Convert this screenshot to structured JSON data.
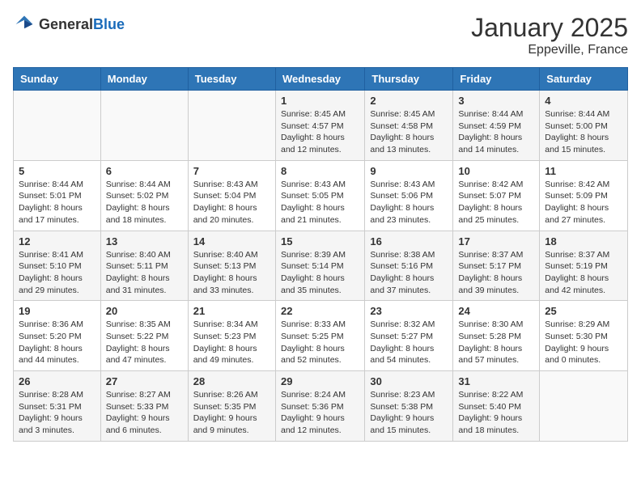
{
  "header": {
    "logo_general": "General",
    "logo_blue": "Blue",
    "month_title": "January 2025",
    "location": "Eppeville, France"
  },
  "days_of_week": [
    "Sunday",
    "Monday",
    "Tuesday",
    "Wednesday",
    "Thursday",
    "Friday",
    "Saturday"
  ],
  "weeks": [
    [
      {
        "day": "",
        "info": ""
      },
      {
        "day": "",
        "info": ""
      },
      {
        "day": "",
        "info": ""
      },
      {
        "day": "1",
        "info": "Sunrise: 8:45 AM\nSunset: 4:57 PM\nDaylight: 8 hours\nand 12 minutes."
      },
      {
        "day": "2",
        "info": "Sunrise: 8:45 AM\nSunset: 4:58 PM\nDaylight: 8 hours\nand 13 minutes."
      },
      {
        "day": "3",
        "info": "Sunrise: 8:44 AM\nSunset: 4:59 PM\nDaylight: 8 hours\nand 14 minutes."
      },
      {
        "day": "4",
        "info": "Sunrise: 8:44 AM\nSunset: 5:00 PM\nDaylight: 8 hours\nand 15 minutes."
      }
    ],
    [
      {
        "day": "5",
        "info": "Sunrise: 8:44 AM\nSunset: 5:01 PM\nDaylight: 8 hours\nand 17 minutes."
      },
      {
        "day": "6",
        "info": "Sunrise: 8:44 AM\nSunset: 5:02 PM\nDaylight: 8 hours\nand 18 minutes."
      },
      {
        "day": "7",
        "info": "Sunrise: 8:43 AM\nSunset: 5:04 PM\nDaylight: 8 hours\nand 20 minutes."
      },
      {
        "day": "8",
        "info": "Sunrise: 8:43 AM\nSunset: 5:05 PM\nDaylight: 8 hours\nand 21 minutes."
      },
      {
        "day": "9",
        "info": "Sunrise: 8:43 AM\nSunset: 5:06 PM\nDaylight: 8 hours\nand 23 minutes."
      },
      {
        "day": "10",
        "info": "Sunrise: 8:42 AM\nSunset: 5:07 PM\nDaylight: 8 hours\nand 25 minutes."
      },
      {
        "day": "11",
        "info": "Sunrise: 8:42 AM\nSunset: 5:09 PM\nDaylight: 8 hours\nand 27 minutes."
      }
    ],
    [
      {
        "day": "12",
        "info": "Sunrise: 8:41 AM\nSunset: 5:10 PM\nDaylight: 8 hours\nand 29 minutes."
      },
      {
        "day": "13",
        "info": "Sunrise: 8:40 AM\nSunset: 5:11 PM\nDaylight: 8 hours\nand 31 minutes."
      },
      {
        "day": "14",
        "info": "Sunrise: 8:40 AM\nSunset: 5:13 PM\nDaylight: 8 hours\nand 33 minutes."
      },
      {
        "day": "15",
        "info": "Sunrise: 8:39 AM\nSunset: 5:14 PM\nDaylight: 8 hours\nand 35 minutes."
      },
      {
        "day": "16",
        "info": "Sunrise: 8:38 AM\nSunset: 5:16 PM\nDaylight: 8 hours\nand 37 minutes."
      },
      {
        "day": "17",
        "info": "Sunrise: 8:37 AM\nSunset: 5:17 PM\nDaylight: 8 hours\nand 39 minutes."
      },
      {
        "day": "18",
        "info": "Sunrise: 8:37 AM\nSunset: 5:19 PM\nDaylight: 8 hours\nand 42 minutes."
      }
    ],
    [
      {
        "day": "19",
        "info": "Sunrise: 8:36 AM\nSunset: 5:20 PM\nDaylight: 8 hours\nand 44 minutes."
      },
      {
        "day": "20",
        "info": "Sunrise: 8:35 AM\nSunset: 5:22 PM\nDaylight: 8 hours\nand 47 minutes."
      },
      {
        "day": "21",
        "info": "Sunrise: 8:34 AM\nSunset: 5:23 PM\nDaylight: 8 hours\nand 49 minutes."
      },
      {
        "day": "22",
        "info": "Sunrise: 8:33 AM\nSunset: 5:25 PM\nDaylight: 8 hours\nand 52 minutes."
      },
      {
        "day": "23",
        "info": "Sunrise: 8:32 AM\nSunset: 5:27 PM\nDaylight: 8 hours\nand 54 minutes."
      },
      {
        "day": "24",
        "info": "Sunrise: 8:30 AM\nSunset: 5:28 PM\nDaylight: 8 hours\nand 57 minutes."
      },
      {
        "day": "25",
        "info": "Sunrise: 8:29 AM\nSunset: 5:30 PM\nDaylight: 9 hours\nand 0 minutes."
      }
    ],
    [
      {
        "day": "26",
        "info": "Sunrise: 8:28 AM\nSunset: 5:31 PM\nDaylight: 9 hours\nand 3 minutes."
      },
      {
        "day": "27",
        "info": "Sunrise: 8:27 AM\nSunset: 5:33 PM\nDaylight: 9 hours\nand 6 minutes."
      },
      {
        "day": "28",
        "info": "Sunrise: 8:26 AM\nSunset: 5:35 PM\nDaylight: 9 hours\nand 9 minutes."
      },
      {
        "day": "29",
        "info": "Sunrise: 8:24 AM\nSunset: 5:36 PM\nDaylight: 9 hours\nand 12 minutes."
      },
      {
        "day": "30",
        "info": "Sunrise: 8:23 AM\nSunset: 5:38 PM\nDaylight: 9 hours\nand 15 minutes."
      },
      {
        "day": "31",
        "info": "Sunrise: 8:22 AM\nSunset: 5:40 PM\nDaylight: 9 hours\nand 18 minutes."
      },
      {
        "day": "",
        "info": ""
      }
    ]
  ]
}
